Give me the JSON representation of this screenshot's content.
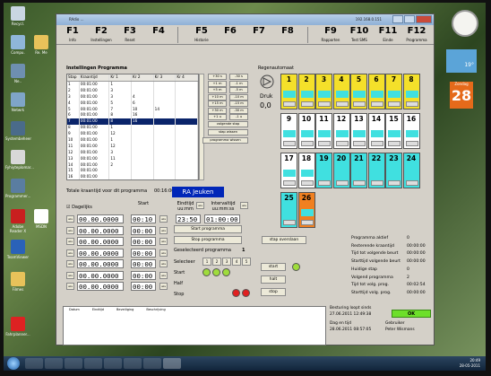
{
  "desktop": {
    "icons": [
      "Recycl.",
      "Compu.",
      "Re. Me",
      "Ne..",
      "Netwrk",
      "Systembeheer",
      "Fyhiyteplomar...",
      "Programmer...",
      "Adobe Reader X",
      "MSDN",
      "TeamViewer",
      "Filmes",
      "Fahrplanner..."
    ],
    "weather_temp": "19°",
    "calendar_day": "28",
    "calendar_label": "Zondag"
  },
  "taskbar": {
    "time": "20:49",
    "date": "28-05-2011"
  },
  "window": {
    "title": "RAdio ...",
    "ip": "192.168.0.151",
    "fkeys": [
      {
        "key": "F1",
        "sub": "Info"
      },
      {
        "key": "F2",
        "sub": "Instellingen"
      },
      {
        "key": "F3",
        "sub": "Reset"
      },
      {
        "key": "F4",
        "sub": ""
      },
      {
        "key": "F5",
        "sub": "Historie"
      },
      {
        "key": "F6",
        "sub": ""
      },
      {
        "key": "F7",
        "sub": ""
      },
      {
        "key": "F8",
        "sub": ""
      },
      {
        "key": "F9",
        "sub": "Rapporten"
      },
      {
        "key": "F10",
        "sub": "Test SMS"
      },
      {
        "key": "F11",
        "sub": "Einde"
      },
      {
        "key": "F12",
        "sub": "Programma"
      }
    ]
  },
  "program": {
    "section_title": "Instellingen Programma",
    "columns": [
      "Stap",
      "Kraantijd",
      "Kr 1",
      "Kr 2",
      "Kr 3",
      "Kr 4"
    ],
    "rows": [
      [
        "1",
        "00:01:00",
        "1",
        "",
        "",
        ""
      ],
      [
        "2",
        "00:01:00",
        "3",
        "",
        "",
        ""
      ],
      [
        "3",
        "00:01:00",
        "3",
        "4",
        "",
        ""
      ],
      [
        "4",
        "00:01:00",
        "5",
        "6",
        "",
        ""
      ],
      [
        "5",
        "00:01:00",
        "7",
        "10",
        "14",
        ""
      ],
      [
        "6",
        "00:01:00",
        "8",
        "16",
        "",
        ""
      ],
      [
        "7",
        "00:01:00",
        "8",
        "16",
        "",
        ""
      ],
      [
        "8",
        "00:01:00",
        "1",
        "",
        "",
        ""
      ],
      [
        "9",
        "00:01:00",
        "12",
        "",
        "",
        ""
      ],
      [
        "10",
        "00:01:00",
        "1",
        "",
        "",
        ""
      ],
      [
        "11",
        "00:01:00",
        "12",
        "",
        "",
        ""
      ],
      [
        "12",
        "00:01:00",
        "3",
        "",
        "",
        ""
      ],
      [
        "13",
        "00:01:00",
        "11",
        "",
        "",
        ""
      ],
      [
        "14",
        "00:01:00",
        "2",
        "",
        "",
        ""
      ],
      [
        "15",
        "00:01:00",
        "",
        "",
        "",
        ""
      ],
      [
        "16",
        "00:01:00",
        "",
        "",
        "",
        ""
      ]
    ],
    "selected_row_index": 6,
    "step_buttons": [
      [
        "+30 s",
        "-30 s"
      ],
      [
        "+1 m",
        "-1 m"
      ],
      [
        "+5 m",
        "-5 m"
      ],
      [
        "+10 m",
        "-10 m"
      ],
      [
        "+15 m",
        "-15 m"
      ],
      [
        "+30 m",
        "-30 m"
      ],
      [
        "+1 u",
        "-1 u"
      ]
    ],
    "next_step_btn": "volgende stap",
    "delete_step_btn": "stap wissen",
    "delete_program_btn": "programma wissen",
    "total_label": "Totale kraantijd voor dit programma",
    "total_value": "00:16:00",
    "program_name": "RA Jeuken"
  },
  "schedule": {
    "daily_label": "Dagelijks",
    "start_label": "Start",
    "end_label": "Eindtijd uu:mm",
    "interval_label": "Intervaltijd uu:mm:ss",
    "wis": "wis",
    "end_value": "23:50",
    "interval_value": "01:00:00",
    "rows": [
      {
        "date": "00.00.0000",
        "time": "00:10"
      },
      {
        "date": "00.00.0000",
        "time": "00:00"
      },
      {
        "date": "00.00.0000",
        "time": "00:00"
      },
      {
        "date": "00.00.0000",
        "time": "00:00"
      },
      {
        "date": "00.00.0000",
        "time": "00:00"
      },
      {
        "date": "00.00.0000",
        "time": "00:00"
      },
      {
        "date": "00.00.0000",
        "time": "00:00"
      }
    ],
    "start_program_btn": "Start programma",
    "stop_program_btn": "Stop programma",
    "selected_prog_label": "Geselecteerd programma",
    "selected_prog_value": "1",
    "select_label": "Selecteer",
    "prog_numbers": [
      "1",
      "2",
      "3",
      "4",
      "5"
    ],
    "halt_label": "Half",
    "stop_label": "Stop"
  },
  "rain": {
    "section_title": "Regenautomaat",
    "pressure_label": "Druk",
    "pressure_value": "0,0",
    "cells": [
      {
        "n": "1",
        "color": "#f4e02a"
      },
      {
        "n": "2",
        "color": "#f4e02a"
      },
      {
        "n": "3",
        "color": "#f4e02a"
      },
      {
        "n": "4",
        "color": "#f4e02a"
      },
      {
        "n": "5",
        "color": "#f4e02a"
      },
      {
        "n": "6",
        "color": "#f4e02a"
      },
      {
        "n": "7",
        "color": "#f4e02a"
      },
      {
        "n": "8",
        "color": "#f4e02a"
      },
      {
        "n": "9",
        "color": "#ffffff"
      },
      {
        "n": "10",
        "color": "#ffffff"
      },
      {
        "n": "11",
        "color": "#ffffff"
      },
      {
        "n": "12",
        "color": "#ffffff"
      },
      {
        "n": "13",
        "color": "#ffffff"
      },
      {
        "n": "14",
        "color": "#ffffff"
      },
      {
        "n": "15",
        "color": "#ffffff"
      },
      {
        "n": "16",
        "color": "#ffffff"
      },
      {
        "n": "17",
        "color": "#ffffff"
      },
      {
        "n": "18",
        "color": "#ffffff"
      },
      {
        "n": "19",
        "color": "#40e0e0"
      },
      {
        "n": "20",
        "color": "#40e0e0"
      },
      {
        "n": "21",
        "color": "#40e0e0"
      },
      {
        "n": "22",
        "color": "#40e0e0"
      },
      {
        "n": "23",
        "color": "#40e0e0"
      },
      {
        "n": "24",
        "color": "#40e0e0"
      },
      {
        "n": "25",
        "color": "#40e0e0"
      },
      {
        "n": "26",
        "color": "#f08020"
      }
    ],
    "stap_overslaan_btn": "stap overslaan",
    "start_btn": "start",
    "halt_btn": "halt",
    "stop_btn": "stop"
  },
  "status": {
    "rows": [
      {
        "label": "Programma aktief",
        "value": "0"
      },
      {
        "label": "Resterende kraantijd",
        "value": "00:00:00"
      },
      {
        "label": "Tijd tot volgende beurt",
        "value": "00:00:00"
      },
      {
        "label": "Starttijd volgende beurt",
        "value": "00:00:00"
      },
      {
        "label": "Huidige stap",
        "value": "0"
      },
      {
        "label": "Volgend programma",
        "value": "2"
      },
      {
        "label": "Tijd tot volg. prog.",
        "value": "00:02:54"
      },
      {
        "label": "Starttijd volg. prog.",
        "value": "00:00:00"
      }
    ],
    "besturing_label": "Besturing loopt sinds",
    "besturing_value": "27.06.2011 12:49:38",
    "ok_label": "OK",
    "dag_label": "Dag en tijd",
    "dag_value": "28.06.2011  08:57:05",
    "gebruiker_label": "Gebruiker",
    "gebruiker_value": "Peter Wismans"
  },
  "bottom_table": {
    "headers": [
      "Datum",
      "Eindtijd",
      "Beveiliging",
      "Beschrijving"
    ]
  }
}
